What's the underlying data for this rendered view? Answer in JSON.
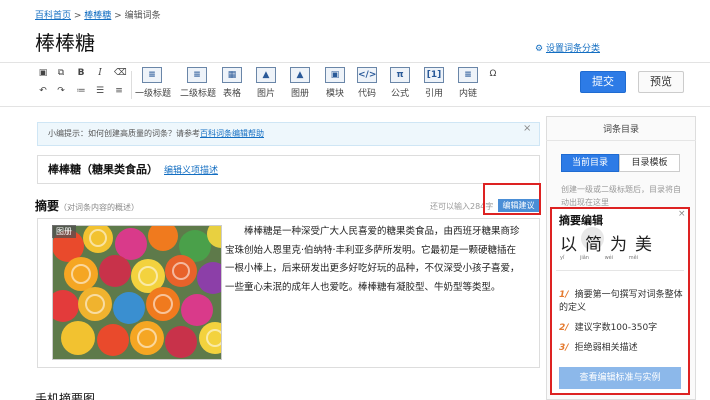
{
  "breadcrumb": {
    "home": "百科首页",
    "sep": " > ",
    "entry": "棒棒糖",
    "current": "编辑词条"
  },
  "page_title": "棒棒糖",
  "set_category": "设置词条分类",
  "toolbar": {
    "items": [
      {
        "label": "一级标题",
        "icon": "heading1-icon",
        "glyph": "≡"
      },
      {
        "label": "二级标题",
        "icon": "heading2-icon",
        "glyph": "≡"
      },
      {
        "label": "表格",
        "icon": "table-icon",
        "glyph": "▦"
      },
      {
        "label": "图片",
        "icon": "image-icon",
        "glyph": "▲"
      },
      {
        "label": "图册",
        "icon": "album-icon",
        "glyph": "▲"
      },
      {
        "label": "模块",
        "icon": "module-icon",
        "glyph": "▣"
      },
      {
        "label": "代码",
        "icon": "code-icon",
        "glyph": "</>"
      },
      {
        "label": "公式",
        "icon": "formula-icon",
        "glyph": "π"
      },
      {
        "label": "引用",
        "icon": "reference-icon",
        "glyph": "[1]"
      },
      {
        "label": "内链",
        "icon": "internal-link-icon",
        "glyph": "≡"
      }
    ],
    "submit_label": "提交",
    "preview_label": "预览"
  },
  "tip": {
    "prefix": "小编提示：如何创建高质量的词条？请参考",
    "link": "百科词条编辑帮助",
    "close": "×"
  },
  "entry": {
    "name": "棒棒糖（糖果类食品）",
    "edit_link": "编辑义项描述"
  },
  "summary": {
    "title": "摘要",
    "subtitle": "（对词条内容的概述）",
    "remaining": "还可以输入284字",
    "suggest_button": "编辑建议",
    "photo_tag": "图册",
    "text": "棒棒糖是一种深受广大人民喜爱的糖果类食品，由西班牙糖果商珍宝珠创始人恩里克·伯纳特·丰利亚多萨所发明。它最初是一颗硬糖插在一根小棒上，后来研发出更多好吃好玩的品种，不仅深受小孩子喜爱，一些童心未泯的成年人也爱吃。棒棒糖有凝胶型、牛奶型等类型。"
  },
  "mobile_title": "手机摘要图",
  "catalog": {
    "title": "词条目录",
    "tab_current": "当前目录",
    "tab_template": "目录模板",
    "hint": "创建一级或二级标题后，目录将自动出现在这里"
  },
  "popup": {
    "title": "摘要编辑",
    "close": "×",
    "calligraphy": "以简为美",
    "pinyin": [
      "yǐ",
      "jiǎn",
      "wéi",
      "měi"
    ],
    "steps": [
      {
        "num": "1/",
        "text": "摘要第一句撰写对词条整体的定义"
      },
      {
        "num": "2/",
        "text": "建议字数100-350字"
      },
      {
        "num": "3/",
        "text": "拒绝弱相关描述"
      }
    ],
    "button": "查看编辑标准与实例"
  },
  "colors": {
    "accent": "#2d7be6",
    "link": "#136ec2",
    "highlight": "#dd2222",
    "step_number": "#e57a2f"
  }
}
